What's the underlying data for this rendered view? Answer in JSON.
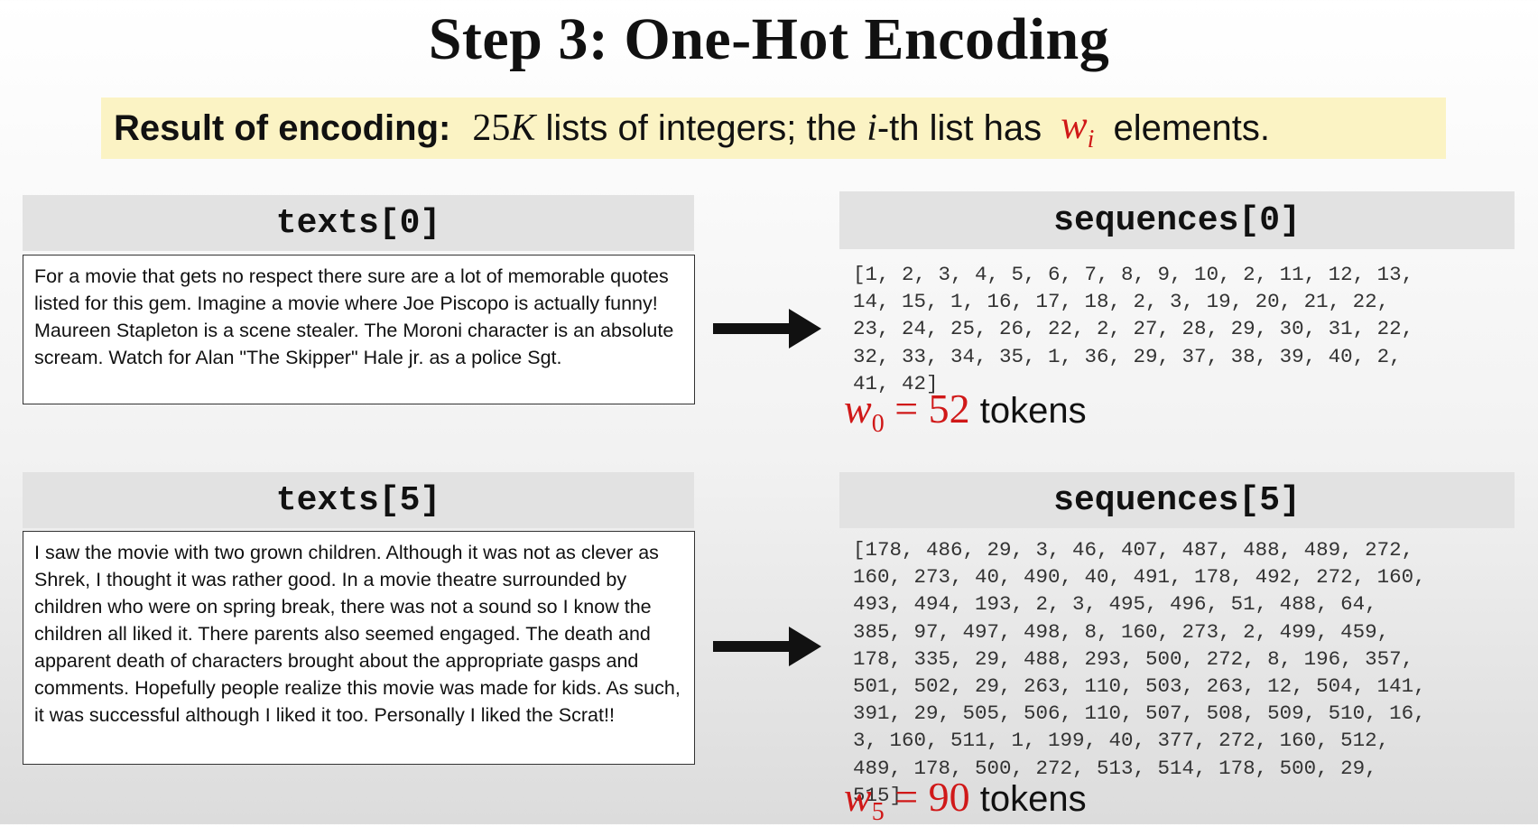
{
  "title": "Step 3: One-Hot Encoding",
  "banner": {
    "bold_label": "Result of encoding:",
    "count": "25",
    "count_unit": "K",
    "text_a": " lists of integers; the ",
    "index_var": "i",
    "text_b": "-th list has ",
    "w_var": "w",
    "w_sub": "i",
    "text_c": " elements."
  },
  "blocks": [
    {
      "text_header": "texts[0]",
      "text": "For a movie that gets no respect there sure are a lot of memorable quotes listed for this gem. Imagine a movie where Joe Piscopo is actually funny! Maureen Stapleton is a scene stealer. The Moroni character is an absolute scream. Watch for Alan \"The Skipper\" Hale jr. as a police Sgt.",
      "seq_header": "sequences[0]",
      "sequence": "[1, 2, 3, 4, 5, 6, 7, 8, 9, 10, 2, 11, 12, 13,\n14, 15, 1, 16, 17, 18, 2, 3, 19, 20, 21, 22,\n23, 24, 25, 26, 22, 2, 27, 28, 29, 30, 31, 22,\n32, 33, 34, 35, 1, 36, 29, 37, 38, 39, 40, 2,\n41, 42]",
      "w_var": "w",
      "w_sub": "0",
      "eq": " = 52",
      "tokens_label": "tokens"
    },
    {
      "text_header": "texts[5]",
      "text": "I saw the movie with two grown children. Although it was not as clever as Shrek, I thought it was rather good. In a movie theatre surrounded by children who were on spring break, there was not a sound so I know the children all liked it. There parents also seemed engaged. The death and apparent death of characters brought about the appropriate gasps and comments. Hopefully people realize this movie was made for kids. As such, it was successful although I liked it too. Personally I liked the Scrat!!",
      "seq_header": "sequences[5]",
      "sequence": "[178, 486, 29, 3, 46, 407, 487, 488, 489, 272,\n160, 273, 40, 490, 40, 491, 178, 492, 272, 160,\n493, 494, 193, 2, 3, 495, 496, 51, 488, 64,\n385, 97, 497, 498, 8, 160, 273, 2, 499, 459,\n178, 335, 29, 488, 293, 500, 272, 8, 196, 357,\n501, 502, 29, 263, 110, 503, 263, 12, 504, 141,\n391, 29, 505, 506, 110, 507, 508, 509, 510, 16,\n3, 160, 511, 1, 199, 40, 377, 272, 160, 512,\n489, 178, 500, 272, 513, 514, 178, 500, 29,\n515]",
      "w_var": "w",
      "w_sub": "5",
      "eq": " = 90",
      "tokens_label": "tokens"
    }
  ]
}
